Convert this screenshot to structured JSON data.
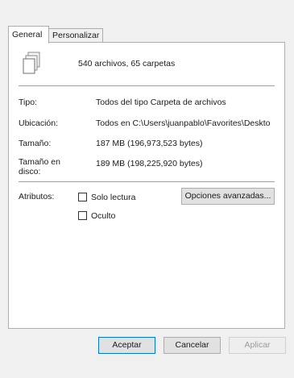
{
  "tabs": [
    {
      "label": "General",
      "active": true
    },
    {
      "label": "Personalizar",
      "active": false
    }
  ],
  "header": {
    "icon": "files-stack-icon",
    "summary": "540 archivos, 65 carpetas"
  },
  "properties": [
    {
      "label": "Tipo:",
      "value": "Todos del tipo Carpeta de archivos"
    },
    {
      "label": "Ubicación:",
      "value": "Todos en C:\\Users\\juanpablo\\Favorites\\Deskto"
    },
    {
      "label": "Tamaño:",
      "value": "187 MB (196,973,523 bytes)"
    },
    {
      "label": "Tamaño en disco:",
      "value": "189 MB (198,225,920 bytes)"
    }
  ],
  "attributes": {
    "label": "Atributos:",
    "readonly": {
      "label": "Solo lectura",
      "checked": false
    },
    "hidden": {
      "label": "Oculto",
      "checked": false
    },
    "advanced_button": "Opciones avanzadas..."
  },
  "footer": {
    "ok": "Aceptar",
    "cancel": "Cancelar",
    "apply": "Aplicar",
    "apply_enabled": false
  }
}
